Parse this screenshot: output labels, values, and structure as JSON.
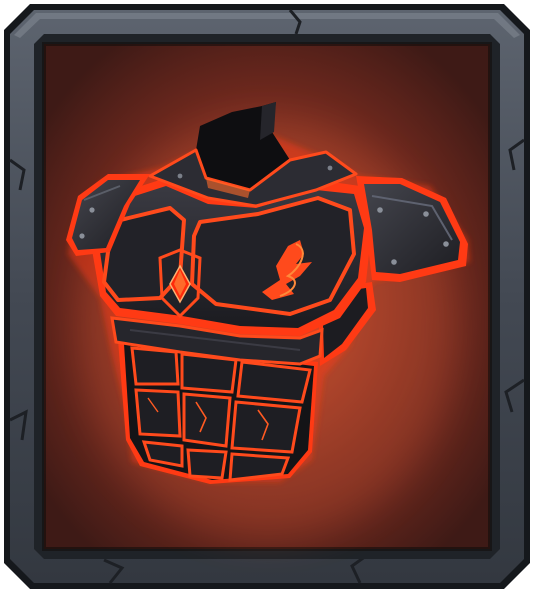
{
  "item_card": {
    "item_icon": "dark-lava-chest-armor-icon",
    "frame_style": "stone-slate-frame",
    "colors": {
      "frame_outer": "#1a1d22",
      "frame_stone": "#4a505a",
      "frame_stone_light": "#6b727d",
      "frame_inner_edge": "#262a30",
      "background_glow": "#a8412a",
      "background_dark": "#4a1f1a",
      "armor_plate": "#2b2b30",
      "armor_plate_dark": "#151518",
      "lava_glow": "#ff3a12",
      "lava_core": "#ff7a2a"
    }
  }
}
